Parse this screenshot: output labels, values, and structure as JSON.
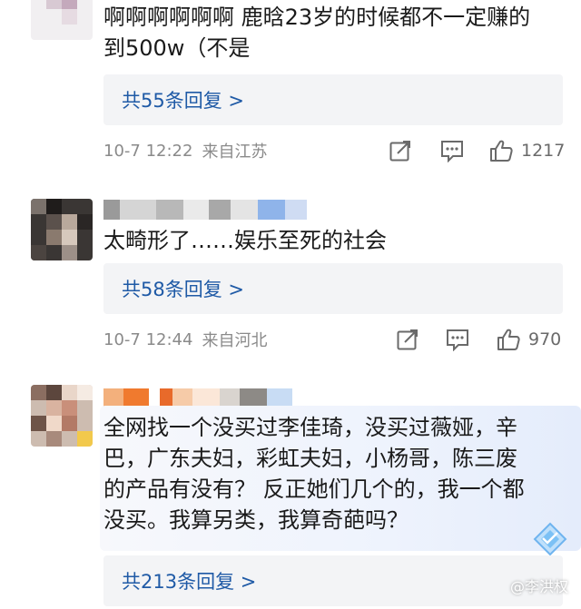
{
  "comments": [
    {
      "body_lines": [
        "啊啊啊啊啊啊 鹿晗23岁的时候都不一定赚的",
        "到500w（不是"
      ],
      "reply_label": "共55条回复 >",
      "timestamp": "10-7 12:22",
      "location": "来自江苏",
      "like_count": "1217"
    },
    {
      "body_lines": [
        "太畸形了……娱乐至死的社会"
      ],
      "reply_label": "共58条回复 >",
      "timestamp": "10-7 12:44",
      "location": "来自河北",
      "like_count": "970"
    },
    {
      "body_lines": [
        "全网找一个没买过李佳琦，没买过薇娅，辛",
        "巴，广东夫妇，彩虹夫妇，小杨哥，陈三废",
        "的产品有没有？ 反正她们几个的，我一个都",
        "没买。我算另类，我算奇葩吗？"
      ],
      "reply_label": "共213条回复 >",
      "timestamp": "",
      "location": "",
      "like_count": ""
    }
  ],
  "watermark": "@李洪权",
  "icons": {
    "share": "share-icon",
    "comment": "comment-icon",
    "like": "thumbs-up-icon",
    "badge": "diamond-badge-icon"
  },
  "colors": {
    "reply_link": "#1f5aa6",
    "meta_text": "#8a8a8a",
    "reply_bg": "#f3f4f6"
  }
}
